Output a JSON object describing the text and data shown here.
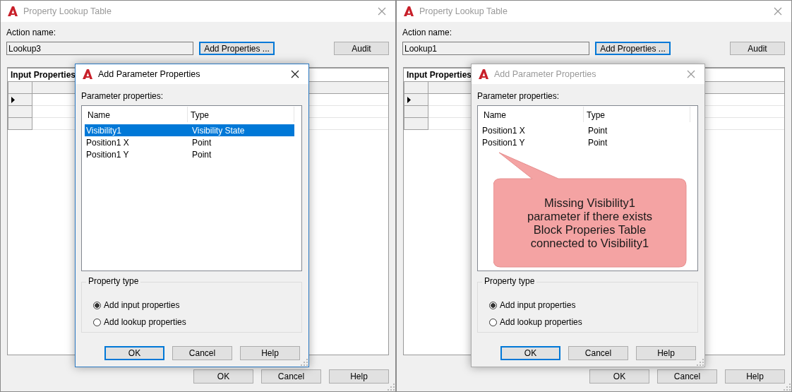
{
  "panels": [
    {
      "window": {
        "title": "Property Lookup Table",
        "active": false
      },
      "action_label": "Action name:",
      "action_name": "Lookup3",
      "top_buttons": [
        {
          "label": "Add Properties ...",
          "default": true
        },
        {
          "label": "Audit",
          "default": false
        }
      ],
      "grid": {
        "header": "Input Properties",
        "row_headers": [
          {
            "current": false
          },
          {
            "current": true
          },
          {
            "current": false
          },
          {
            "current": false
          }
        ]
      },
      "footer_buttons": [
        {
          "label": "OK",
          "default": false
        },
        {
          "label": "Cancel",
          "default": false
        },
        {
          "label": "Help",
          "default": false
        }
      ],
      "dialog": {
        "title": "Add Parameter Properties",
        "active": true,
        "list_label": "Parameter properties:",
        "columns": [
          "Name",
          "Type"
        ],
        "rows": [
          {
            "name": "Visibility1",
            "type": "Visibility State",
            "selected": true
          },
          {
            "name": "Position1 X",
            "type": "Point",
            "selected": false
          },
          {
            "name": "Position1 Y",
            "type": "Point",
            "selected": false
          }
        ],
        "group_label": "Property type",
        "options": [
          {
            "label": "Add input properties",
            "selected": true
          },
          {
            "label": "Add lookup properties",
            "selected": false
          }
        ],
        "buttons": [
          {
            "label": "OK",
            "default": true
          },
          {
            "label": "Cancel",
            "default": false
          },
          {
            "label": "Help",
            "default": false
          }
        ]
      }
    },
    {
      "window": {
        "title": "Property Lookup Table",
        "active": false
      },
      "action_label": "Action name:",
      "action_name": "Lookup1",
      "top_buttons": [
        {
          "label": "Add Properties ...",
          "default": true
        },
        {
          "label": "Audit",
          "default": false
        }
      ],
      "grid": {
        "header": "Input Properties",
        "row_headers": [
          {
            "current": false
          },
          {
            "current": true
          },
          {
            "current": false
          },
          {
            "current": false
          }
        ]
      },
      "footer_buttons": [
        {
          "label": "OK",
          "default": false
        },
        {
          "label": "Cancel",
          "default": false
        },
        {
          "label": "Help",
          "default": false
        }
      ],
      "dialog": {
        "title": "Add Parameter Properties",
        "active": false,
        "list_label": "Parameter properties:",
        "columns": [
          "Name",
          "Type"
        ],
        "rows": [
          {
            "name": "Position1 X",
            "type": "Point",
            "selected": false
          },
          {
            "name": "Position1 Y",
            "type": "Point",
            "selected": false
          }
        ],
        "group_label": "Property type",
        "options": [
          {
            "label": "Add input properties",
            "selected": true
          },
          {
            "label": "Add lookup properties",
            "selected": false
          }
        ],
        "buttons": [
          {
            "label": "OK",
            "default": true
          },
          {
            "label": "Cancel",
            "default": false
          },
          {
            "label": "Help",
            "default": false
          }
        ]
      },
      "callout": {
        "text": "Missing Visibility1\nparameter if there exists\nBlock Properies Table\nconnected to Visibility1"
      }
    }
  ]
}
